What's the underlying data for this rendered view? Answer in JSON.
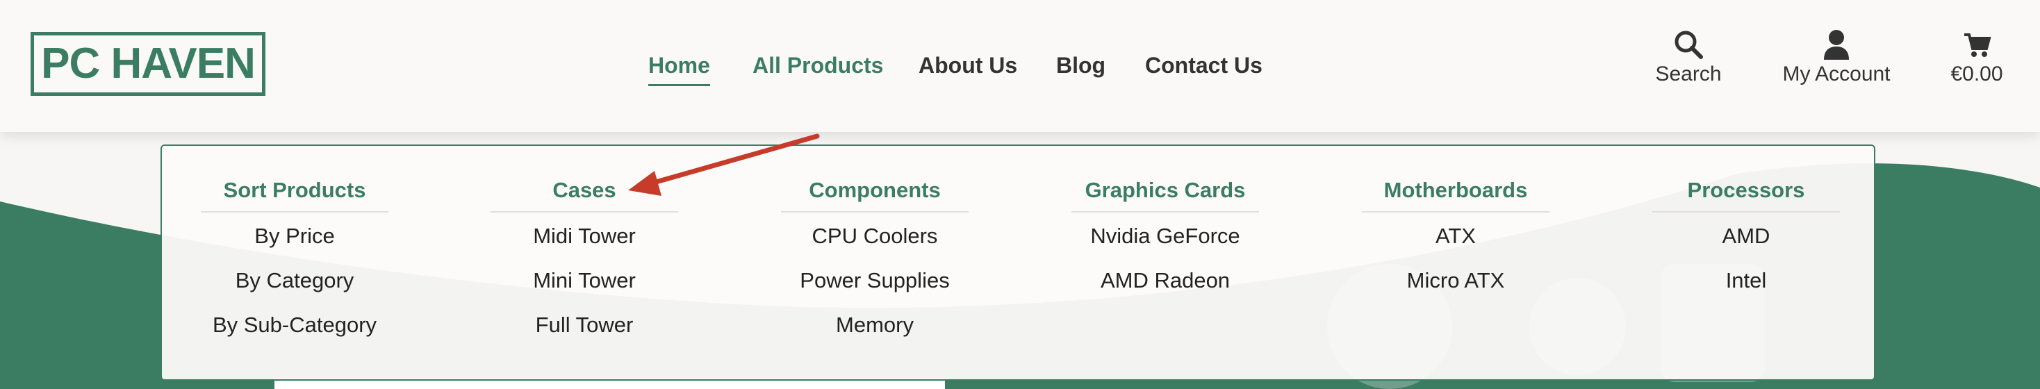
{
  "brand": {
    "logo_text": "PC HAVEN",
    "accent": "#3b7d63"
  },
  "nav": {
    "items": [
      {
        "label": "Home",
        "active": true
      },
      {
        "label": "All Products"
      },
      {
        "label": "About Us"
      },
      {
        "label": "Blog"
      },
      {
        "label": "Contact Us"
      }
    ]
  },
  "header_actions": {
    "search_label": "Search",
    "account_label": "My Account",
    "cart_label": "€0.00",
    "icons": [
      "search-icon",
      "user-icon",
      "cart-icon"
    ]
  },
  "mega_menu": {
    "columns": [
      {
        "heading": "Sort Products",
        "items": [
          "By Price",
          "By Category",
          "By Sub-Category"
        ]
      },
      {
        "heading": "Cases",
        "items": [
          "Midi Tower",
          "Mini Tower",
          "Full Tower"
        ]
      },
      {
        "heading": "Components",
        "items": [
          "CPU Coolers",
          "Power Supplies",
          "Memory"
        ]
      },
      {
        "heading": "Graphics Cards",
        "items": [
          "Nvidia GeForce",
          "AMD Radeon"
        ]
      },
      {
        "heading": "Motherboards",
        "items": [
          "ATX",
          "Micro ATX"
        ]
      },
      {
        "heading": "Processors",
        "items": [
          "AMD",
          "Intel"
        ]
      }
    ]
  },
  "annotation": {
    "arrow_color": "#c63b2a"
  }
}
